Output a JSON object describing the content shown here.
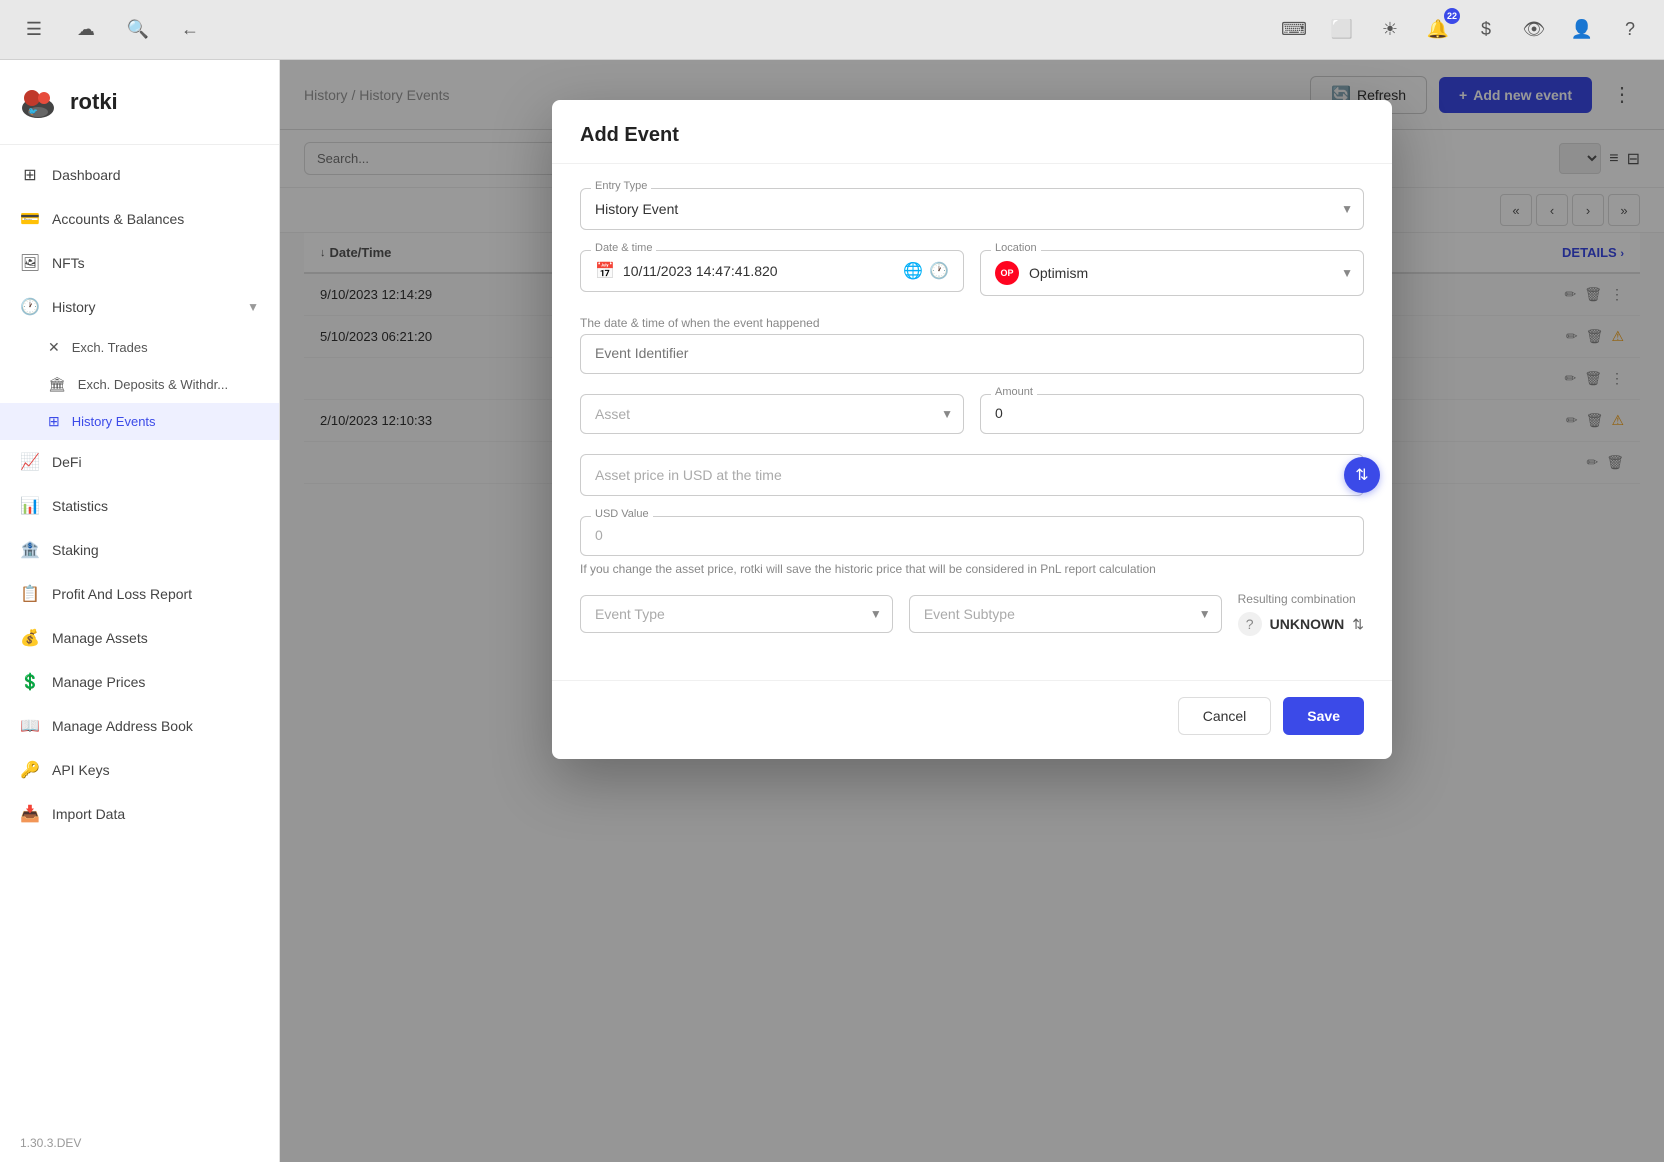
{
  "topbar": {
    "hamburger_label": "☰",
    "cloud_icon": "☁",
    "search_icon": "🔍",
    "back_icon": "←",
    "code_icon": "⌨",
    "window_icon": "⬜",
    "settings_icon": "☀",
    "notification_count": "22",
    "dollar_icon": "$",
    "eye_icon": "👁",
    "user_icon": "👤",
    "help_icon": "?"
  },
  "sidebar": {
    "logo_text": "rotki",
    "version": "1.30.3.DEV",
    "nav_items": [
      {
        "id": "dashboard",
        "label": "Dashboard",
        "icon": "⊞"
      },
      {
        "id": "accounts",
        "label": "Accounts & Balances",
        "icon": "💳"
      },
      {
        "id": "nfts",
        "label": "NFTs",
        "icon": "🖼"
      },
      {
        "id": "history",
        "label": "History",
        "icon": "🕐",
        "expanded": true
      },
      {
        "id": "defi",
        "label": "DeFi",
        "icon": "📈"
      },
      {
        "id": "statistics",
        "label": "Statistics",
        "icon": "📊"
      },
      {
        "id": "staking",
        "label": "Staking",
        "icon": "🏦"
      },
      {
        "id": "pnl",
        "label": "Profit And Loss Report",
        "icon": "📋"
      },
      {
        "id": "manage-assets",
        "label": "Manage Assets",
        "icon": "💰"
      },
      {
        "id": "manage-prices",
        "label": "Manage Prices",
        "icon": "💲"
      },
      {
        "id": "manage-address-book",
        "label": "Manage Address Book",
        "icon": "📖"
      },
      {
        "id": "api-keys",
        "label": "API Keys",
        "icon": "🔑"
      },
      {
        "id": "import-data",
        "label": "Import Data",
        "icon": "📥"
      }
    ],
    "history_sub_items": [
      {
        "id": "exch-trades",
        "label": "Exch. Trades",
        "icon": "✕"
      },
      {
        "id": "exch-deposits",
        "label": "Exch. Deposits & Withdr...",
        "icon": "🏛"
      },
      {
        "id": "history-events",
        "label": "History Events",
        "icon": "⊞",
        "active": true
      }
    ]
  },
  "header": {
    "breadcrumb_parent": "History",
    "breadcrumb_separator": "/",
    "breadcrumb_current": "History Events",
    "refresh_label": "Refresh",
    "add_event_label": "Add new event",
    "more_icon": "⋮"
  },
  "table": {
    "date_column": "Date/Time",
    "details_column": "DETAILS",
    "rows": [
      {
        "date": "9/10/2023 12:14:29"
      },
      {
        "date": "5/10/2023 06:21:20",
        "warning": true
      },
      {
        "date": "2/10/2023 12:10:33",
        "warning": true
      }
    ]
  },
  "modal": {
    "title": "Add Event",
    "entry_type_label": "Entry Type",
    "entry_type_value": "History Event",
    "datetime_label": "Date & time",
    "datetime_value": "10/11/2023 14:47:41.820",
    "datetime_hint": "The date & time of when the event happened",
    "location_label": "Location",
    "location_value": "Optimism",
    "location_badge": "OP",
    "event_identifier_placeholder": "Event Identifier",
    "asset_placeholder": "Asset",
    "amount_label": "Amount",
    "amount_value": "0",
    "asset_price_placeholder": "Asset price in USD at the time",
    "price_toggle_icon": "⇅",
    "usd_label": "USD Value",
    "usd_value": "0",
    "usd_hint": "If you change the asset price, rotki will save the historic price that will be considered in PnL report calculation",
    "event_type_placeholder": "Event Type",
    "event_subtype_placeholder": "Event Subtype",
    "resulting_combination_label": "Resulting combination",
    "unknown_label": "UNKNOWN",
    "cancel_label": "Cancel",
    "save_label": "Save"
  },
  "pagination": {
    "first_icon": "«",
    "prev_icon": "‹",
    "next_icon": "›",
    "last_icon": "»"
  }
}
